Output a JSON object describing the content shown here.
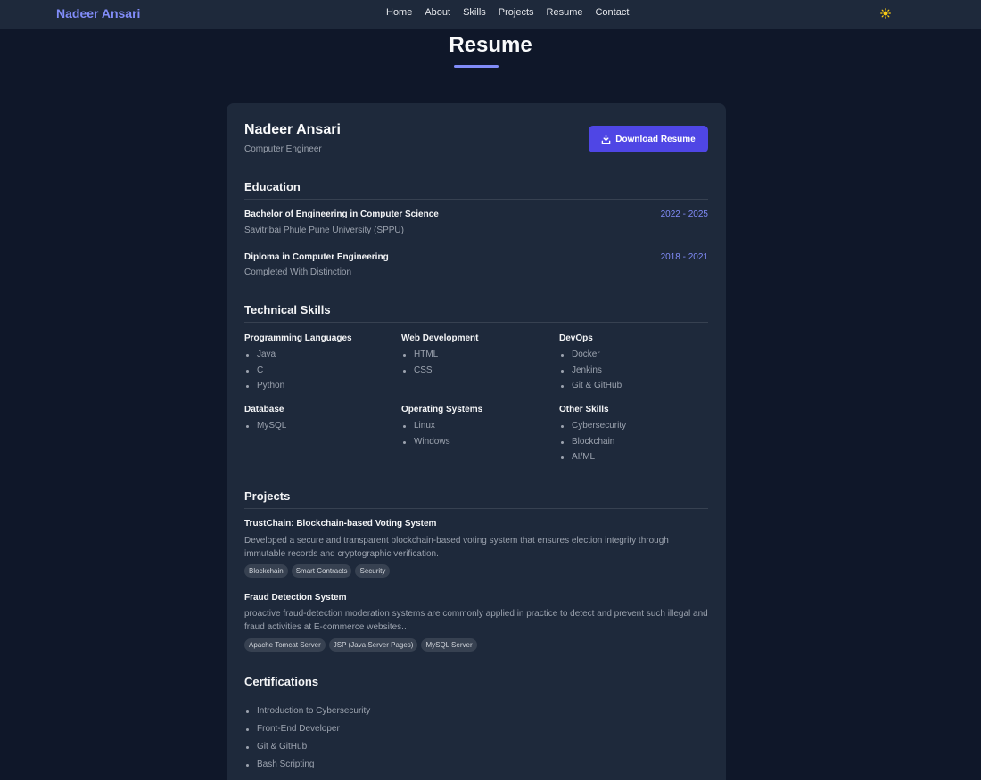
{
  "nav": {
    "brand": "Nadeer Ansari",
    "links": [
      "Home",
      "About",
      "Skills",
      "Projects",
      "Resume",
      "Contact"
    ],
    "active": "Resume",
    "theme_icon": "sun-icon",
    "accent_color": "#818cf8"
  },
  "page_title": "Resume",
  "resume": {
    "name": "Nadeer Ansari",
    "role": "Computer Engineer",
    "download_label": "Download Resume",
    "download_icon": "download-icon",
    "button_color": "#4f46e5"
  },
  "education": {
    "heading": "Education",
    "items": [
      {
        "degree": "Bachelor of Engineering in Computer Science",
        "school": "Savitribai Phule Pune University (SPPU)",
        "dates": "2022 - 2025"
      },
      {
        "degree": "Diploma in Computer Engineering",
        "school": "Completed With Distinction",
        "dates": "2018 - 2021"
      }
    ]
  },
  "skills": {
    "heading": "Technical Skills",
    "groups": [
      {
        "title": "Programming Languages",
        "items": [
          "Java",
          "C",
          "Python"
        ]
      },
      {
        "title": "Web Development",
        "items": [
          "HTML",
          "CSS"
        ]
      },
      {
        "title": "DevOps",
        "items": [
          "Docker",
          "Jenkins",
          "Git & GitHub"
        ]
      },
      {
        "title": "Database",
        "items": [
          "MySQL"
        ]
      },
      {
        "title": "Operating Systems",
        "items": [
          "Linux",
          "Windows"
        ]
      },
      {
        "title": "Other Skills",
        "items": [
          "Cybersecurity",
          "Blockchain",
          "AI/ML"
        ]
      }
    ]
  },
  "projects": {
    "heading": "Projects",
    "items": [
      {
        "title": "TrustChain: Blockchain-based Voting System",
        "description": "Developed a secure and transparent blockchain-based voting system that ensures election integrity through immutable records and cryptographic verification.",
        "tags": [
          "Blockchain",
          "Smart Contracts",
          "Security"
        ]
      },
      {
        "title": "Fraud Detection System",
        "description": "proactive fraud-detection moderation systems are commonly applied in practice to detect and prevent such illegal and fraud activities at E-commerce websites..",
        "tags": [
          "Apache Tomcat Server",
          "JSP (Java Server Pages)",
          "MySQL Server"
        ]
      }
    ]
  },
  "certifications": {
    "heading": "Certifications",
    "items": [
      "Introduction to Cybersecurity",
      "Front-End Developer",
      "Git & GitHub",
      "Bash Scripting"
    ]
  }
}
